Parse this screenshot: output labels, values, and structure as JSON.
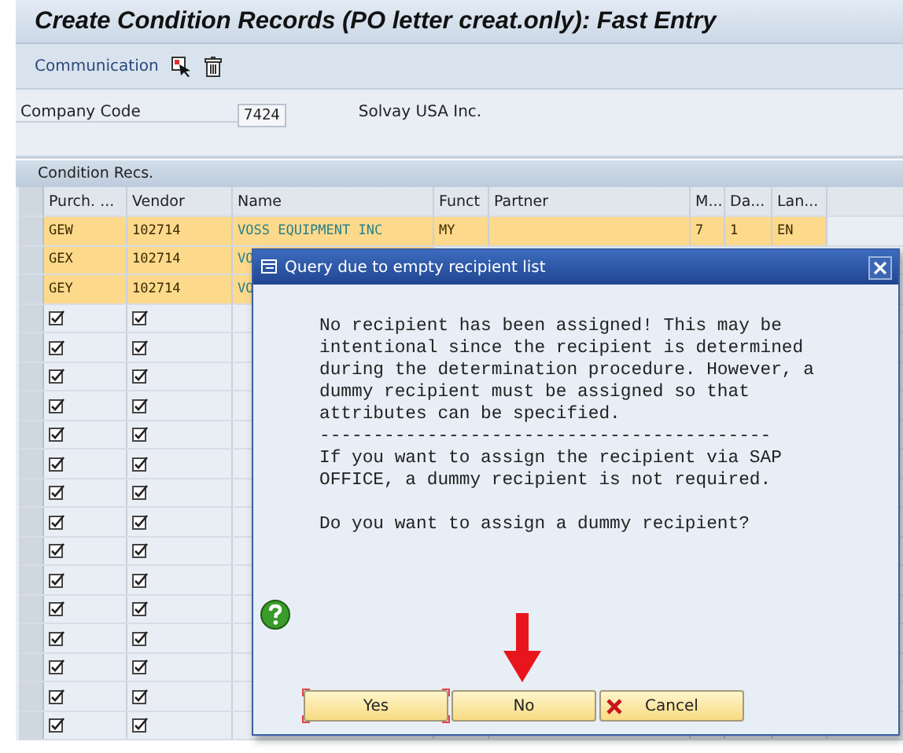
{
  "window": {
    "title": "Create Condition Records (PO letter creat.only): Fast Entry"
  },
  "toolbar": {
    "menu_label": "Communication"
  },
  "company": {
    "label": "Company Code",
    "value": "7424",
    "description": "Solvay USA Inc."
  },
  "section": {
    "title": "Condition Recs."
  },
  "table": {
    "columns": [
      "Purch. ...",
      "Vendor",
      "Name",
      "Funct",
      "Partner",
      "M...",
      "Da...",
      "Lan..."
    ],
    "rows": [
      {
        "kind": "record",
        "cells": [
          "GEW",
          "102714",
          "VOSS EQUIPMENT INC",
          "MY",
          "",
          "7",
          "1",
          "EN"
        ]
      },
      {
        "kind": "record",
        "cells": [
          "GEX",
          "102714",
          "VO"
        ]
      },
      {
        "kind": "record",
        "cells": [
          "GEY",
          "102714",
          "VO"
        ]
      },
      {
        "kind": "empty"
      },
      {
        "kind": "empty"
      },
      {
        "kind": "empty"
      },
      {
        "kind": "empty"
      },
      {
        "kind": "empty"
      },
      {
        "kind": "empty"
      },
      {
        "kind": "empty"
      },
      {
        "kind": "empty"
      },
      {
        "kind": "empty"
      },
      {
        "kind": "empty"
      },
      {
        "kind": "empty"
      },
      {
        "kind": "empty"
      },
      {
        "kind": "empty"
      },
      {
        "kind": "empty"
      },
      {
        "kind": "empty"
      }
    ]
  },
  "dialog": {
    "title": "Query due to empty recipient list",
    "message": "No recipient has been assigned! This may be\nintentional since the recipient is determined\nduring the determination procedure. However, a\ndummy recipient must be assigned so that\nattributes can be specified.",
    "separator": "------------------------------------------",
    "note": "If you want to assign the recipient via SAP\nOFFICE, a dummy recipient is not required.",
    "question": "Do you want to assign a dummy recipient?",
    "buttons": [
      {
        "kind": "plain",
        "label": "Yes",
        "focused": true
      },
      {
        "kind": "plain",
        "label": "No",
        "focused": false
      },
      {
        "kind": "cancel",
        "label": "Cancel",
        "focused": false
      }
    ]
  }
}
